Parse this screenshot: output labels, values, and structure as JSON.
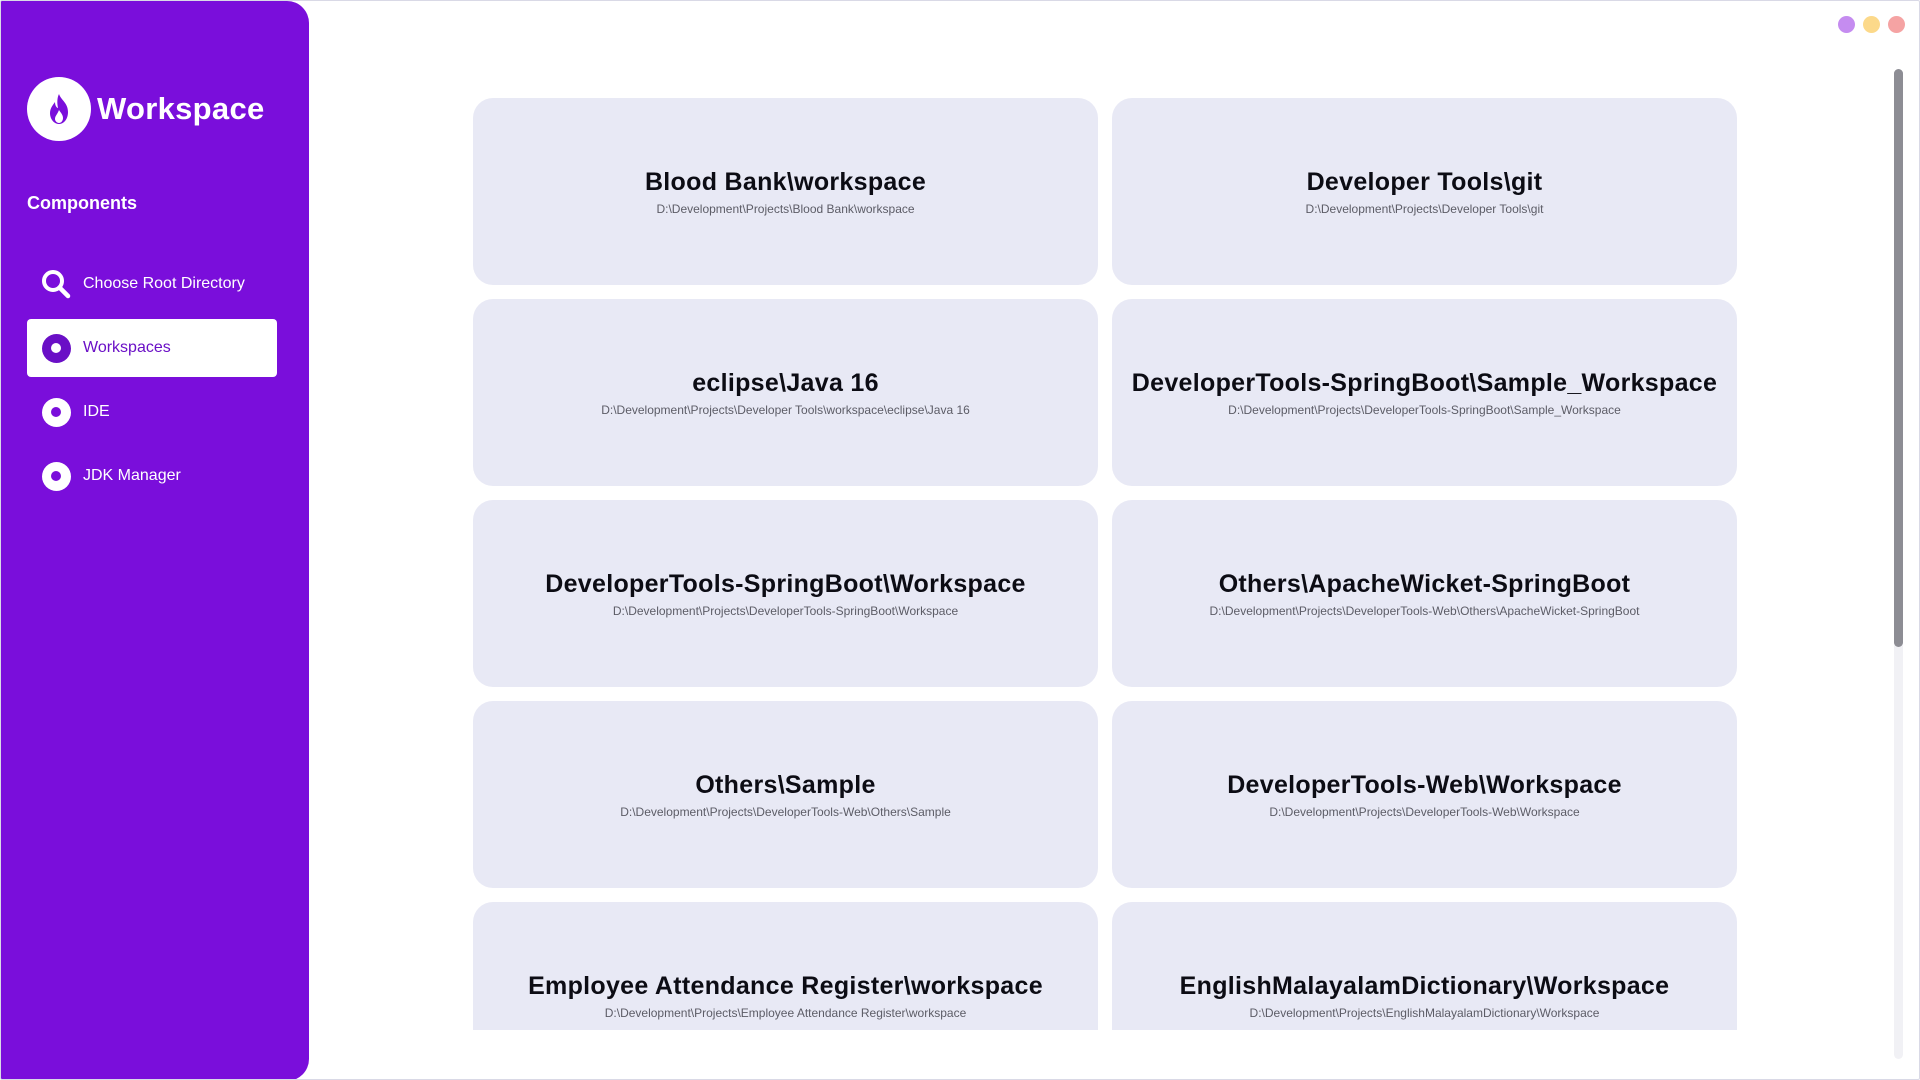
{
  "app": {
    "title": "Workspace",
    "section_label": "Components"
  },
  "nav": [
    {
      "label": "Choose Root Directory",
      "icon": "search-icon",
      "active": false
    },
    {
      "label": "Workspaces",
      "icon": "radio-dot-icon",
      "active": true
    },
    {
      "label": "IDE",
      "icon": "radio-dot-icon",
      "active": false
    },
    {
      "label": "JDK Manager",
      "icon": "radio-dot-icon",
      "active": false
    }
  ],
  "window_controls": [
    {
      "name": "minimize",
      "color": "#c58cf0"
    },
    {
      "name": "maximize",
      "color": "#fcd98a"
    },
    {
      "name": "close",
      "color": "#f5a3a3"
    }
  ],
  "workspaces": [
    {
      "title": "Blood Bank\\workspace",
      "path": "D:\\Development\\Projects\\Blood Bank\\workspace"
    },
    {
      "title": "Developer Tools\\git",
      "path": "D:\\Development\\Projects\\Developer Tools\\git"
    },
    {
      "title": "eclipse\\Java 16",
      "path": "D:\\Development\\Projects\\Developer Tools\\workspace\\eclipse\\Java 16"
    },
    {
      "title": "DeveloperTools-SpringBoot\\Sample_Workspace",
      "path": "D:\\Development\\Projects\\DeveloperTools-SpringBoot\\Sample_Workspace"
    },
    {
      "title": "DeveloperTools-SpringBoot\\Workspace",
      "path": "D:\\Development\\Projects\\DeveloperTools-SpringBoot\\Workspace"
    },
    {
      "title": "Others\\ApacheWicket-SpringBoot",
      "path": "D:\\Development\\Projects\\DeveloperTools-Web\\Others\\ApacheWicket-SpringBoot"
    },
    {
      "title": "Others\\Sample",
      "path": "D:\\Development\\Projects\\DeveloperTools-Web\\Others\\Sample"
    },
    {
      "title": "DeveloperTools-Web\\Workspace",
      "path": "D:\\Development\\Projects\\DeveloperTools-Web\\Workspace"
    },
    {
      "title": "Employee Attendance Register\\workspace",
      "path": "D:\\Development\\Projects\\Employee Attendance Register\\workspace"
    },
    {
      "title": "EnglishMalayalamDictionary\\Workspace",
      "path": "D:\\Development\\Projects\\EnglishMalayalamDictionary\\Workspace"
    }
  ],
  "colors": {
    "sidebar": "#7a0edb",
    "card": "#e8e9f5",
    "active_text": "#6a0fc6"
  }
}
